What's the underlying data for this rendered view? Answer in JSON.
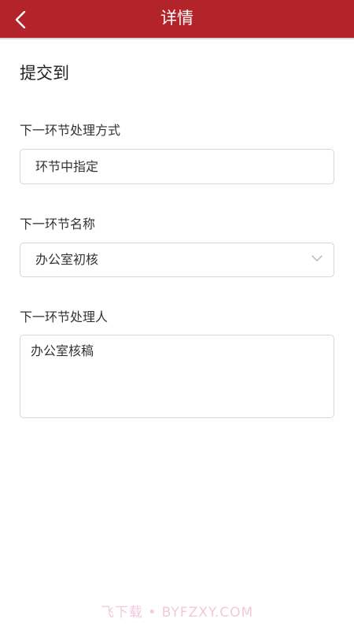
{
  "header": {
    "title": "详情",
    "back_icon": "chevron-left-icon",
    "bg_color": "#b2242a"
  },
  "form": {
    "section_title": "提交到",
    "process_mode": {
      "label": "下一环节处理方式",
      "value": "环节中指定"
    },
    "step_name": {
      "label": "下一环节名称",
      "value": "办公室初核",
      "icon": "chevron-down-icon"
    },
    "handler": {
      "label": "下一环节处理人",
      "value": "办公室核稿"
    }
  },
  "watermark": "飞下载 • BYFZXY.COM"
}
